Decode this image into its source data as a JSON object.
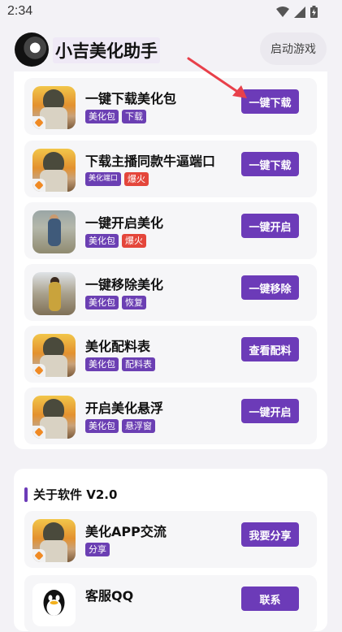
{
  "status_bar": {
    "time": "2:34"
  },
  "header": {
    "title": "小吉美化助手",
    "start_button": "启动游戏"
  },
  "features": [
    {
      "title": "一键下载美化包",
      "tags": [
        {
          "text": "美化包",
          "color": "purple"
        },
        {
          "text": "下载",
          "color": "purple"
        }
      ],
      "action": "一键下载"
    },
    {
      "title": "下载主播同款牛逼端口",
      "tags": [
        {
          "text": "美化端口",
          "color": "purple"
        },
        {
          "text": "爆火",
          "color": "red"
        }
      ],
      "action": "一键下载"
    },
    {
      "title": "一键开启美化",
      "tags": [
        {
          "text": "美化包",
          "color": "purple"
        },
        {
          "text": "爆火",
          "color": "red"
        }
      ],
      "action": "一键开启"
    },
    {
      "title": "一键移除美化",
      "tags": [
        {
          "text": "美化包",
          "color": "purple"
        },
        {
          "text": "恢复",
          "color": "purple"
        }
      ],
      "action": "一键移除"
    },
    {
      "title": "美化配料表",
      "tags": [
        {
          "text": "美化包",
          "color": "purple"
        },
        {
          "text": "配料表",
          "color": "purple"
        }
      ],
      "action": "查看配料"
    },
    {
      "title": "开启美化悬浮",
      "tags": [
        {
          "text": "美化包",
          "color": "purple"
        },
        {
          "text": "悬浮窗",
          "color": "purple"
        }
      ],
      "action": "一键开启"
    }
  ],
  "about": {
    "title": "关于软件 V2.0",
    "items": [
      {
        "title": "美化APP交流",
        "tags": [
          {
            "text": "分享",
            "color": "purple"
          }
        ],
        "action": "我要分享"
      },
      {
        "title": "客服QQ",
        "tags": [],
        "action": "联系"
      }
    ]
  },
  "colors": {
    "accent": "#6c3bb8",
    "tag_red": "#e4463b",
    "arrow": "#e8404a"
  }
}
